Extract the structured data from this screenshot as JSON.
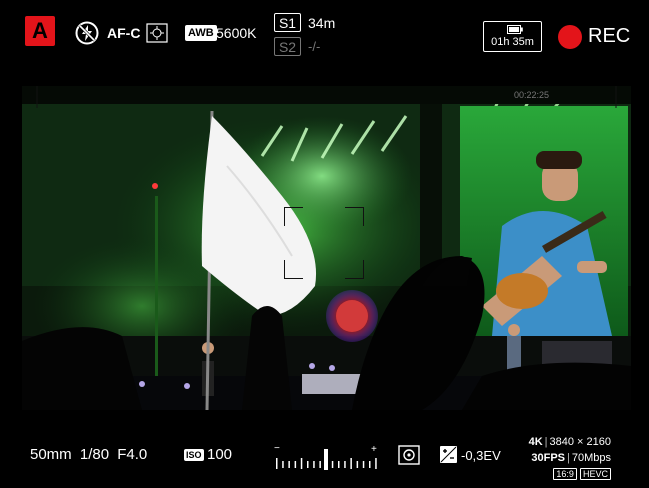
{
  "top_bar": {
    "mode": "A",
    "flash_icon": "flash-off-icon",
    "af_mode": "AF-C",
    "af_area_icon": "af-area-icon",
    "awb_badge": "AWB",
    "white_balance": "5600K",
    "slot1": {
      "label": "S1",
      "remaining": "34m"
    },
    "slot2": {
      "label": "S2",
      "remaining": "-/-"
    },
    "battery_icon": "battery-icon",
    "battery_time": "01h 35m",
    "rec_label": "REC",
    "rec_color": "#e3141a"
  },
  "bottom_bar": {
    "focal_length": "50mm",
    "shutter": "1/80",
    "aperture": "F4.0",
    "iso_badge": "ISO",
    "iso": "100",
    "meter_minus": "−",
    "meter_plus": "+",
    "metering_icon": "metering-mode-icon",
    "ev_icon": "exposure-compensation-icon",
    "exposure_compensation": "-0,3EV",
    "resolution_label": "4K",
    "resolution": "3840 × 2160",
    "fps": "30FPS",
    "bitrate": "70Mbps",
    "aspect": "16:9",
    "codec": "HEVC"
  }
}
